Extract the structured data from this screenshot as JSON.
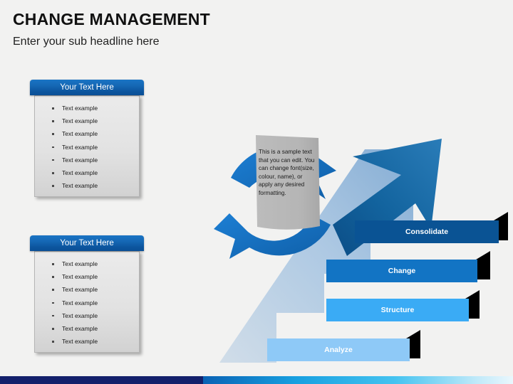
{
  "header": {
    "title": "CHANGE MANAGEMENT",
    "subtitle": "Enter your sub headline here"
  },
  "panels": [
    {
      "header": "Your Text Here",
      "items": [
        "Text example",
        "Text example",
        "Text example",
        "Text example",
        "Text example",
        "Text example",
        "Text example"
      ]
    },
    {
      "header": "Your Text Here",
      "items": [
        "Text example",
        "Text example",
        "Text example",
        "Text example",
        "Text example",
        "Text example",
        "Text example"
      ]
    }
  ],
  "note": {
    "text": "This is a sample text that you can edit. You can change font(size, colour, name), or apply any desired formatting."
  },
  "steps": [
    {
      "label": "Consolidate",
      "color": "#0a5394"
    },
    {
      "label": "Change",
      "color": "#1274c4"
    },
    {
      "label": "Structure",
      "color": "#3aabf5"
    },
    {
      "label": "Analyze",
      "color": "#8ec9f7"
    }
  ],
  "colors": {
    "background": "#f2f2f1",
    "accent_dark": "#0a5394",
    "accent_mid": "#1274c4",
    "accent_light": "#3aabf5",
    "accent_pale": "#8ec9f7",
    "panel_header_blue": "#1567b4",
    "note_gray": "#b8b8b8",
    "bottom_navy": "#13206b",
    "bottom_cyan": "#29b6ea"
  }
}
